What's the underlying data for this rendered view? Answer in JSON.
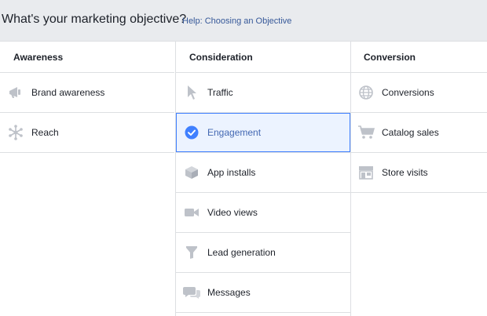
{
  "header": {
    "title": "What's your marketing objective?",
    "help_link": "Help: Choosing an Objective"
  },
  "columns": [
    {
      "heading": "Awareness",
      "items": [
        {
          "label": "Brand awareness",
          "icon": "megaphone-icon"
        },
        {
          "label": "Reach",
          "icon": "reach-icon"
        }
      ]
    },
    {
      "heading": "Consideration",
      "items": [
        {
          "label": "Traffic",
          "icon": "cursor-icon"
        },
        {
          "label": "Engagement",
          "icon": "checkmark-circle-icon",
          "selected": true
        },
        {
          "label": "App installs",
          "icon": "box-icon"
        },
        {
          "label": "Video views",
          "icon": "video-camera-icon"
        },
        {
          "label": "Lead generation",
          "icon": "funnel-icon"
        },
        {
          "label": "Messages",
          "icon": "chat-bubbles-icon"
        }
      ]
    },
    {
      "heading": "Conversion",
      "items": [
        {
          "label": "Conversions",
          "icon": "globe-icon"
        },
        {
          "label": "Catalog sales",
          "icon": "shopping-cart-icon"
        },
        {
          "label": "Store visits",
          "icon": "storefront-icon"
        }
      ]
    }
  ],
  "colors": {
    "icon_gray": "#bec2c9",
    "accent_blue": "#4080ff",
    "selected_bg": "#ecf3ff",
    "link": "#365899"
  }
}
